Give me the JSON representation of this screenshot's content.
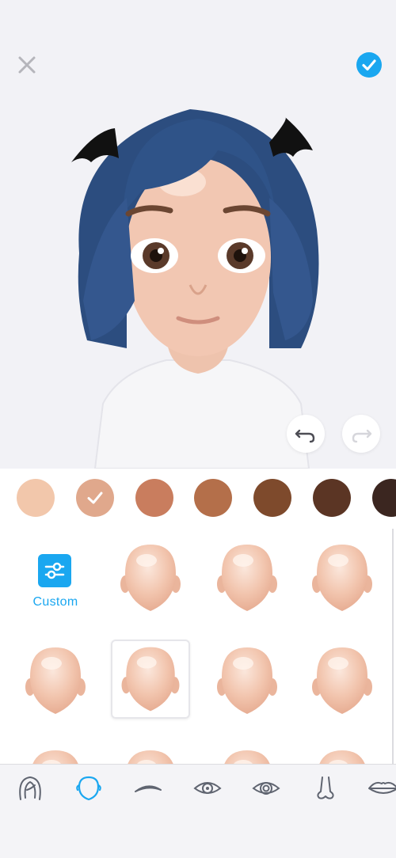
{
  "header": {
    "close_icon": "close-icon",
    "confirm_icon": "check-circle-icon",
    "accent": "#1aa7f0"
  },
  "preview": {
    "undo_icon": "undo-icon",
    "redo_icon": "redo-icon"
  },
  "skin_tones": [
    {
      "color": "#f2c7ab",
      "selected": false
    },
    {
      "color": "#e0a88c",
      "selected": true
    },
    {
      "color": "#c97d5e",
      "selected": false
    },
    {
      "color": "#b46f4a",
      "selected": false
    },
    {
      "color": "#7e4a2c",
      "selected": false
    },
    {
      "color": "#5b3524",
      "selected": false
    },
    {
      "color": "#3b2620",
      "selected": false
    }
  ],
  "face_options": {
    "custom_label": "Custom",
    "selected_index": 4
  },
  "bottom_tabs": [
    {
      "name": "hair-tab",
      "icon": "hair-icon",
      "active": false
    },
    {
      "name": "face-shape-tab",
      "icon": "face-shape-icon",
      "active": true
    },
    {
      "name": "eyebrows-tab",
      "icon": "eyebrow-icon",
      "active": false
    },
    {
      "name": "eyes-tab",
      "icon": "eye-icon",
      "active": false
    },
    {
      "name": "eye-color-tab",
      "icon": "eye-color-icon",
      "active": false
    },
    {
      "name": "nose-tab",
      "icon": "nose-icon",
      "active": false
    },
    {
      "name": "lips-tab",
      "icon": "lips-icon",
      "active": false
    }
  ]
}
